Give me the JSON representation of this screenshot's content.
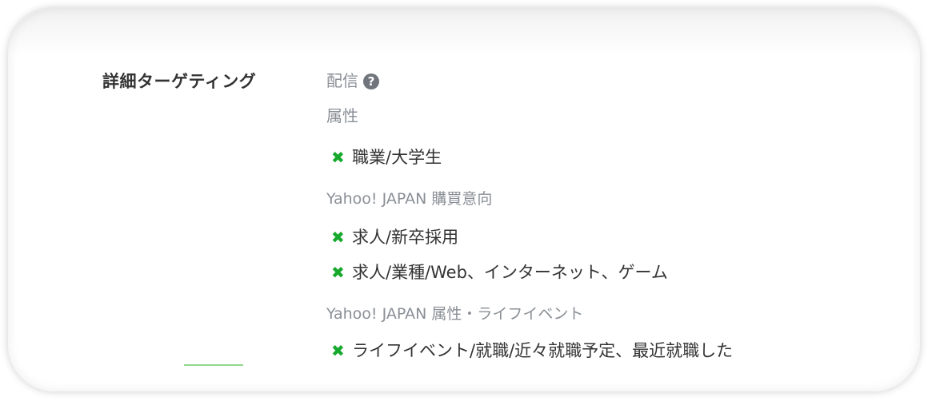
{
  "targeting": {
    "section_label": "詳細ターゲティング",
    "delivery_heading": "配信",
    "help_icon_glyph": "?",
    "attributes": {
      "heading": "属性",
      "items": [
        {
          "label": "職業/大学生"
        }
      ]
    },
    "purchase_intent": {
      "heading": "Yahoo! JAPAN 購買意向",
      "items": [
        {
          "label": "求人/新卒採用"
        },
        {
          "label": "求人/業種/Web、インターネット、ゲーム"
        }
      ]
    },
    "life_events": {
      "heading": "Yahoo! JAPAN 属性・ライフイベント",
      "items": [
        {
          "label": "ライフイベント/就職/近々就職予定、最近就職した"
        }
      ]
    },
    "remove_icon_glyph": "✖",
    "colors": {
      "remove_icon": "#17a82e",
      "heading_text": "#8a8f96",
      "body_text": "#333333"
    }
  }
}
